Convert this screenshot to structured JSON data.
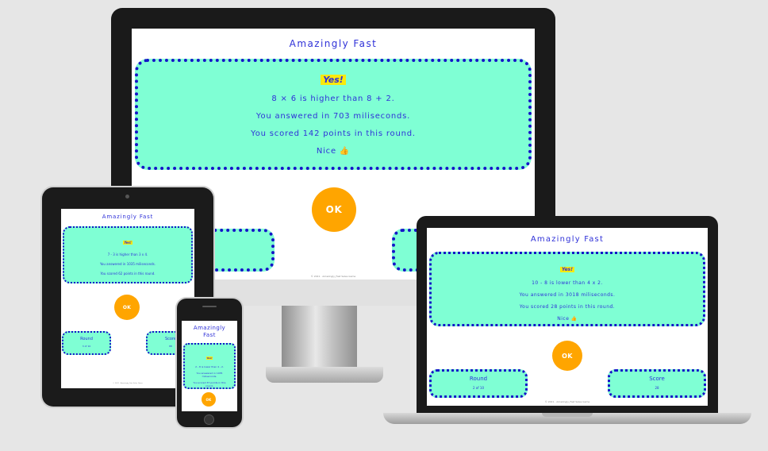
{
  "app_title": "Amazingly Fast",
  "ok_label": "OK",
  "yes_label": "Yes!",
  "nice_label": "Nice 👍",
  "round_label": "Round",
  "score_label": "Score",
  "footer": "© 2021 · Amazingly_Fast Sales Game",
  "desktop": {
    "comparison": "8 × 6 is higher than 8 + 2.",
    "answer_time": "You answered in 703 miliseconds.",
    "scored": "You scored 142 points in this round."
  },
  "tablet": {
    "comparison": "7 - 3 is higher than 3 x 4.",
    "answer_time": "You answered in 1035 miliseconds.",
    "scored": "You scored 62 points in this round.",
    "round_value": "3 of 10",
    "score_value": "88"
  },
  "laptop": {
    "comparison": "10 - 8 is lower than 4 x 2.",
    "answer_time": "You answered in 3018 miliseconds.",
    "scored": "You scored 28 points in this round.",
    "round_value": "2 of 10",
    "score_value": "28"
  },
  "phone": {
    "title_line1": "Amazingly",
    "title_line2": "Fast",
    "comparison": "2 - 8 is lower than 4 - 2.",
    "answer_time": "You answered in 1035 miliseconds.",
    "scored": "You scored 37 points in this round."
  },
  "colors": {
    "background": "#e6e6e6",
    "card": "#7fffd4",
    "card_border": "#1515c8",
    "text": "#2f31d8",
    "ok_button": "#ffa500",
    "yes_highlight": "#fbe90a"
  }
}
